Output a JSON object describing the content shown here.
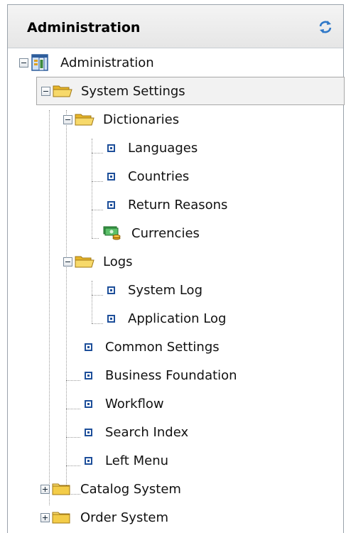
{
  "header": {
    "title": "Administration",
    "refresh_icon": "refresh-icon"
  },
  "tree": {
    "root": {
      "label": "Administration",
      "icon": "administration-icon",
      "expanded": true
    },
    "system_settings": {
      "label": "System Settings",
      "icon": "folder-open-icon",
      "expanded": true,
      "selected": true
    },
    "dictionaries": {
      "label": "Dictionaries",
      "icon": "folder-open-icon",
      "expanded": true
    },
    "languages": {
      "label": "Languages",
      "icon": "leaf-node-icon"
    },
    "countries": {
      "label": "Countries",
      "icon": "leaf-node-icon"
    },
    "return_reasons": {
      "label": "Return Reasons",
      "icon": "leaf-node-icon"
    },
    "currencies": {
      "label": "Currencies",
      "icon": "currency-icon"
    },
    "logs": {
      "label": "Logs",
      "icon": "folder-open-icon",
      "expanded": true
    },
    "system_log": {
      "label": "System Log",
      "icon": "leaf-node-icon"
    },
    "application_log": {
      "label": "Application Log",
      "icon": "leaf-node-icon"
    },
    "common_settings": {
      "label": "Common Settings",
      "icon": "leaf-node-icon"
    },
    "business_foundation": {
      "label": "Business Foundation",
      "icon": "leaf-node-icon"
    },
    "workflow": {
      "label": "Workflow",
      "icon": "leaf-node-icon"
    },
    "search_index": {
      "label": "Search Index",
      "icon": "leaf-node-icon"
    },
    "left_menu": {
      "label": "Left Menu",
      "icon": "leaf-node-icon"
    },
    "catalog_system": {
      "label": "Catalog System",
      "icon": "folder-closed-icon",
      "expanded": false
    },
    "order_system": {
      "label": "Order System",
      "icon": "folder-closed-icon",
      "expanded": false
    }
  },
  "colors": {
    "border": "#9aa2ab",
    "header_bg": "#e6e6e6",
    "folder": "#f0c53a",
    "bullet": "#1e4f9a"
  }
}
